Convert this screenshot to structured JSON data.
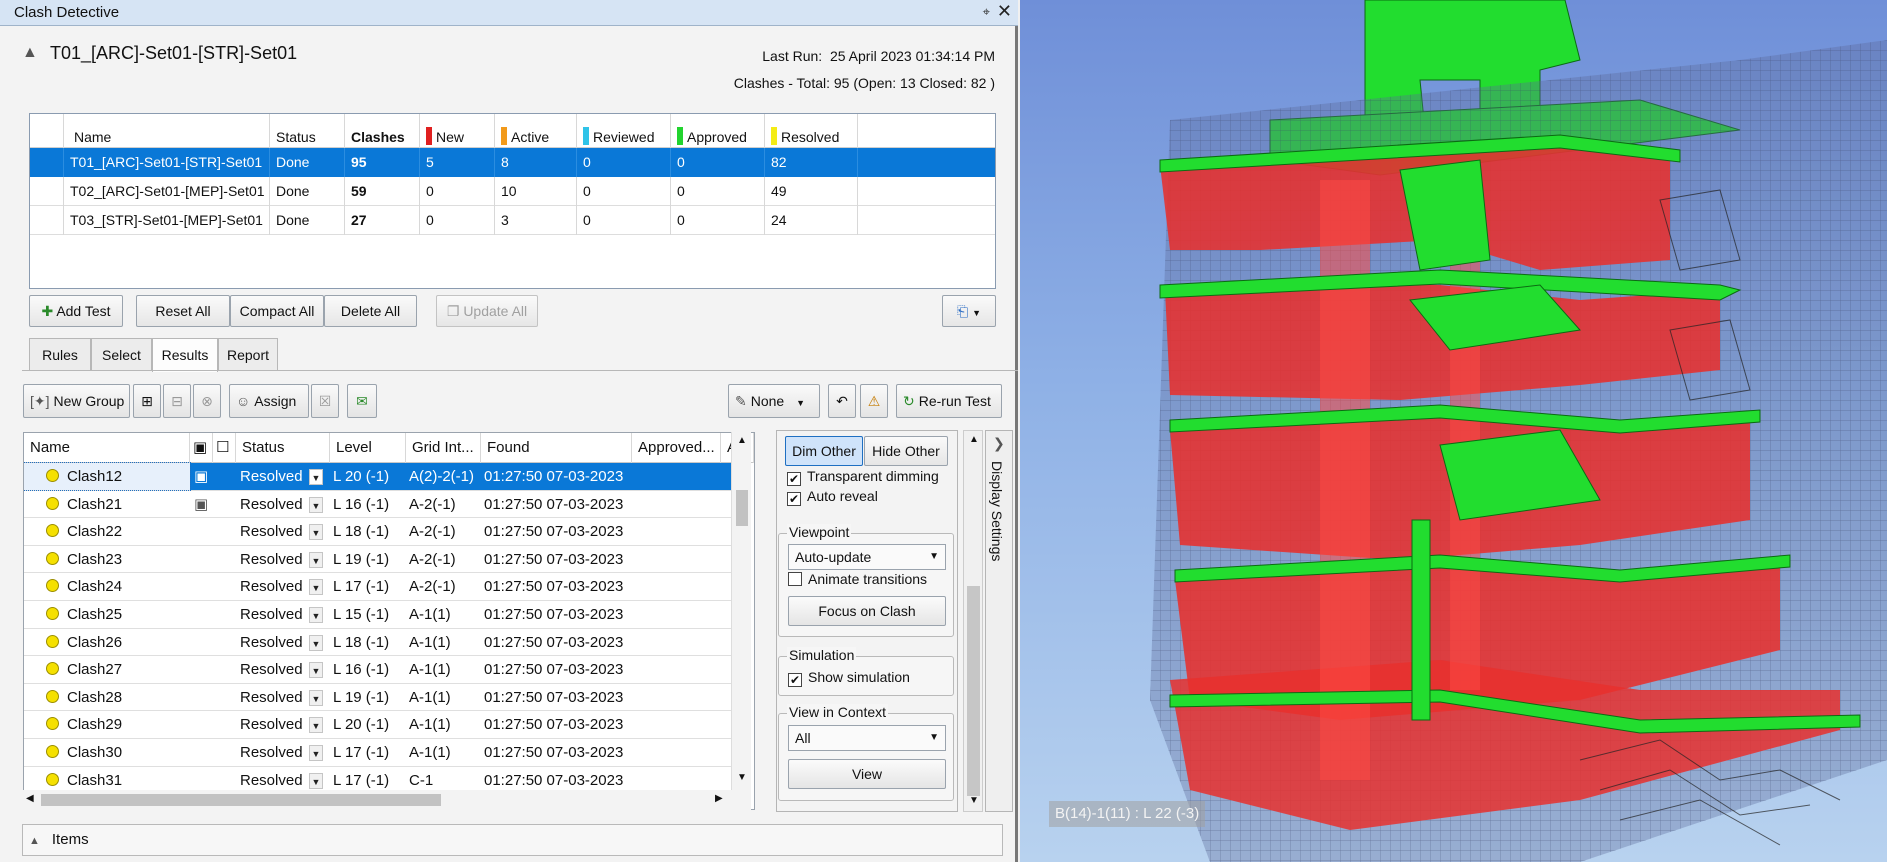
{
  "window": {
    "title": "Clash Detective"
  },
  "header": {
    "test_name": "T01_[ARC]-Set01-[STR]-Set01",
    "last_run_label": "Last Run:",
    "last_run": "25 April 2023 01:34:14 PM",
    "summary": "Clashes -  Total:  95  (Open:  13  Closed:  82 )"
  },
  "tests_table": {
    "columns": [
      "Name",
      "Status",
      "Clashes",
      "New",
      "Active",
      "Reviewed",
      "Approved",
      "Resolved"
    ],
    "status_colors": {
      "New": "#e02020",
      "Active": "#f29a1a",
      "Reviewed": "#2fc3e8",
      "Approved": "#22d42f",
      "Resolved": "#f4ec16"
    },
    "rows": [
      {
        "name": "T01_[ARC]-Set01-[STR]-Set01",
        "status": "Done",
        "clashes": "95",
        "new": "5",
        "active": "8",
        "reviewed": "0",
        "approved": "0",
        "resolved": "82"
      },
      {
        "name": "T02_[ARC]-Set01-[MEP]-Set01",
        "status": "Done",
        "clashes": "59",
        "new": "0",
        "active": "10",
        "reviewed": "0",
        "approved": "0",
        "resolved": "49"
      },
      {
        "name": "T03_[STR]-Set01-[MEP]-Set01",
        "status": "Done",
        "clashes": "27",
        "new": "0",
        "active": "3",
        "reviewed": "0",
        "approved": "0",
        "resolved": "24"
      }
    ]
  },
  "test_buttons": {
    "add": "Add Test",
    "reset": "Reset All",
    "compact": "Compact All",
    "delete": "Delete All",
    "update": "Update All"
  },
  "tabs": [
    "Rules",
    "Select",
    "Results",
    "Report"
  ],
  "results_toolbar": {
    "new_group": "New Group",
    "assign": "Assign",
    "none": "None",
    "rerun": "Re-run Test"
  },
  "results_table": {
    "columns": [
      "Name",
      "Status",
      "Level",
      "Grid Int...",
      "Found",
      "Approved...",
      "A"
    ],
    "rows": [
      {
        "name": "Clash12",
        "status": "Resolved",
        "level": "L 20 (-1)",
        "grid": "A(2)-2(-1)",
        "found": "01:27:50 07-03-2023"
      },
      {
        "name": "Clash21",
        "status": "Resolved",
        "level": "L 16 (-1)",
        "grid": "A-2(-1)",
        "found": "01:27:50 07-03-2023"
      },
      {
        "name": "Clash22",
        "status": "Resolved",
        "level": "L 18 (-1)",
        "grid": "A-2(-1)",
        "found": "01:27:50 07-03-2023"
      },
      {
        "name": "Clash23",
        "status": "Resolved",
        "level": "L 19 (-1)",
        "grid": "A-2(-1)",
        "found": "01:27:50 07-03-2023"
      },
      {
        "name": "Clash24",
        "status": "Resolved",
        "level": "L 17 (-1)",
        "grid": "A-2(-1)",
        "found": "01:27:50 07-03-2023"
      },
      {
        "name": "Clash25",
        "status": "Resolved",
        "level": "L 15 (-1)",
        "grid": "A-1(1)",
        "found": "01:27:50 07-03-2023"
      },
      {
        "name": "Clash26",
        "status": "Resolved",
        "level": "L 18 (-1)",
        "grid": "A-1(1)",
        "found": "01:27:50 07-03-2023"
      },
      {
        "name": "Clash27",
        "status": "Resolved",
        "level": "L 16 (-1)",
        "grid": "A-1(1)",
        "found": "01:27:50 07-03-2023"
      },
      {
        "name": "Clash28",
        "status": "Resolved",
        "level": "L 19 (-1)",
        "grid": "A-1(1)",
        "found": "01:27:50 07-03-2023"
      },
      {
        "name": "Clash29",
        "status": "Resolved",
        "level": "L 20 (-1)",
        "grid": "A-1(1)",
        "found": "01:27:50 07-03-2023"
      },
      {
        "name": "Clash30",
        "status": "Resolved",
        "level": "L 17 (-1)",
        "grid": "A-1(1)",
        "found": "01:27:50 07-03-2023"
      },
      {
        "name": "Clash31",
        "status": "Resolved",
        "level": "L 17 (-1)",
        "grid": "C-1",
        "found": "01:27:50 07-03-2023"
      }
    ]
  },
  "display_settings": {
    "strip_label": "Display Settings",
    "dim_other": "Dim Other",
    "hide_other": "Hide Other",
    "transparent_dimming": "Transparent dimming",
    "auto_reveal": "Auto reveal",
    "viewpoint_title": "Viewpoint",
    "viewpoint_value": "Auto-update",
    "animate_transitions": "Animate transitions",
    "focus_on_clash": "Focus on Clash",
    "simulation_title": "Simulation",
    "show_simulation": "Show simulation",
    "view_in_context_title": "View in Context",
    "view_in_context_value": "All",
    "view_button": "View"
  },
  "items_panel": {
    "label": "Items"
  },
  "viewport": {
    "coordinate_readout": "B(14)-1(11) : L 22 (-3)"
  }
}
